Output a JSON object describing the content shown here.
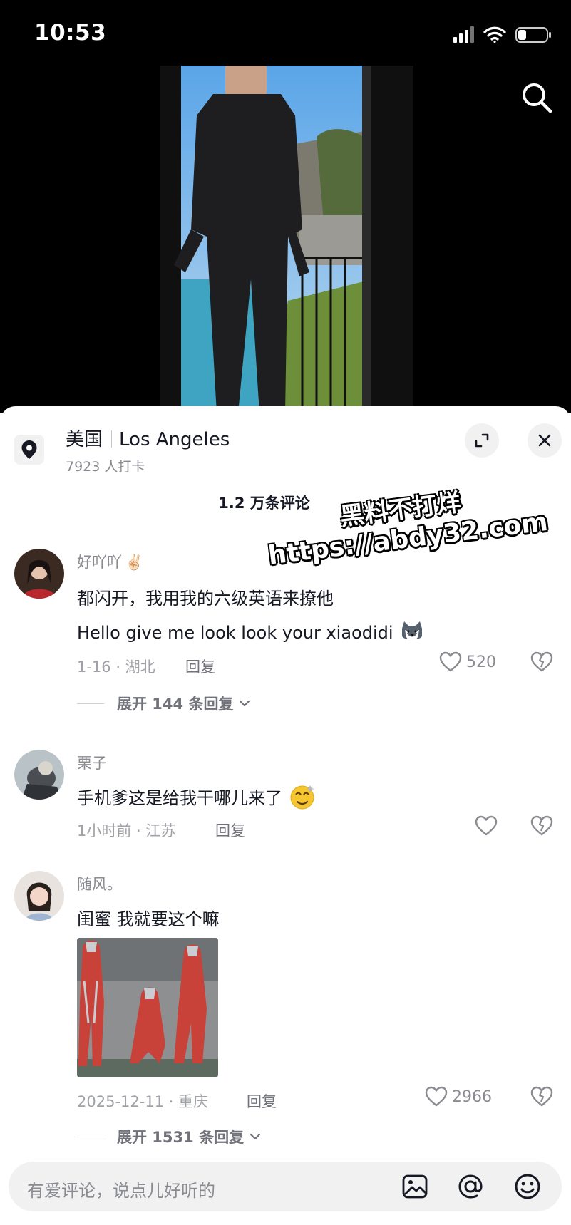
{
  "status_bar": {
    "time": "10:53",
    "icons": [
      "signal-icon",
      "wifi-icon",
      "battery-icon"
    ]
  },
  "location": {
    "country": "美国",
    "city": "Los Angeles",
    "checkins": "7923 人打卡"
  },
  "comments_header": {
    "count": "1.2 万条评论"
  },
  "watermark": {
    "line1": "黑料不打烊",
    "line2": "https://abdy32.com"
  },
  "comments": [
    {
      "name": "好吖吖",
      "name_emoji": "✌🏻",
      "lines": [
        "都闪开，我用我的六级英语来撩他",
        "Hello give me look look your xiaodidi"
      ],
      "meta": "1-16 · 湖北",
      "reply": "回复",
      "likes": "520",
      "expand": "展开 144 条回复"
    },
    {
      "name": "栗子",
      "lines": [
        "手机爹这是给我干哪儿来了"
      ],
      "meta": "1小时前 · 江苏",
      "reply": "回复",
      "likes": "",
      "expand": ""
    },
    {
      "name": "随风。",
      "lines": [
        "闺蜜 我就要这个嘛"
      ],
      "meta": "2025-12-11 · 重庆",
      "reply": "回复",
      "likes": "2966",
      "expand": "展开 1531 条回复"
    }
  ],
  "input": {
    "placeholder": "有爱评论，说点儿好听的"
  },
  "colors": {
    "text": "#161823",
    "secondary": "#8a8b91",
    "sheet_bg": "#ffffff",
    "input_bg": "#f1f1f2"
  }
}
